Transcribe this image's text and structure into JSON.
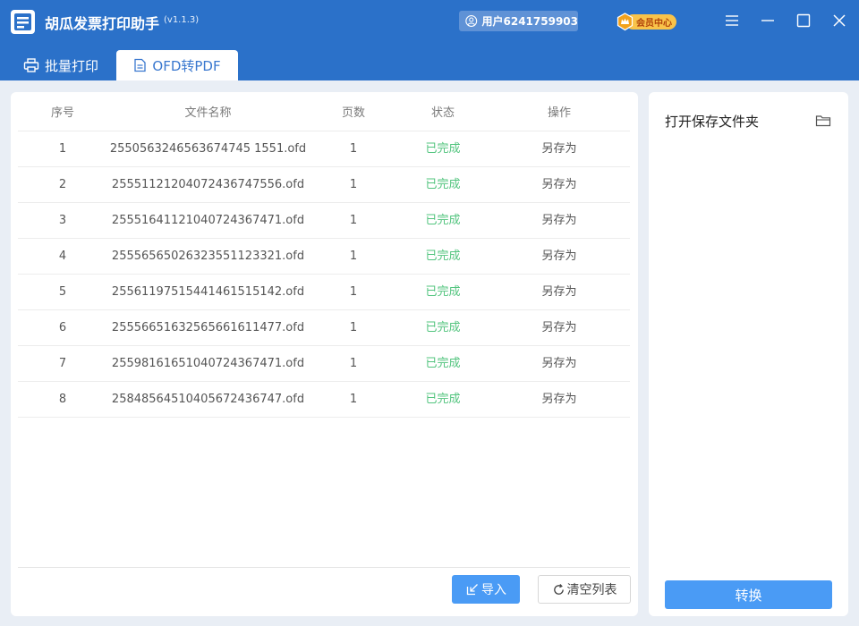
{
  "app": {
    "title": "胡瓜发票打印助手",
    "version": "(v1.1.3)",
    "user_label": "用户6241759903",
    "vip_label": "会员中心"
  },
  "colors": {
    "brand": "#2b71c9",
    "accent": "#4a9bf5",
    "status_done": "#52c47e",
    "vip": "#f9c34a"
  },
  "window_controls": [
    "menu-icon",
    "minimize-icon",
    "maximize-icon",
    "close-icon"
  ],
  "tabs": [
    {
      "label": "批量打印",
      "icon": "printer-icon",
      "active": false
    },
    {
      "label": "OFD转PDF",
      "icon": "document-icon",
      "active": true
    }
  ],
  "table": {
    "columns": [
      "序号",
      "文件名称",
      "页数",
      "状态",
      "操作"
    ],
    "rows": [
      {
        "index": "1",
        "name": "2550563246563674745 1551.ofd",
        "pages": "1",
        "status": "已完成",
        "action": "另存为"
      },
      {
        "index": "2",
        "name": "25551121204072436747556.ofd",
        "pages": "1",
        "status": "已完成",
        "action": "另存为"
      },
      {
        "index": "3",
        "name": "25551641121040724367471.ofd",
        "pages": "1",
        "status": "已完成",
        "action": "另存为"
      },
      {
        "index": "4",
        "name": "25556565026323551123321.ofd",
        "pages": "1",
        "status": "已完成",
        "action": "另存为"
      },
      {
        "index": "5",
        "name": "25561197515441461515142.ofd",
        "pages": "1",
        "status": "已完成",
        "action": "另存为"
      },
      {
        "index": "6",
        "name": "25556651632565661611477.ofd",
        "pages": "1",
        "status": "已完成",
        "action": "另存为"
      },
      {
        "index": "7",
        "name": "25598161651040724367471.ofd",
        "pages": "1",
        "status": "已完成",
        "action": "另存为"
      },
      {
        "index": "8",
        "name": "25848564510405672436747.ofd",
        "pages": "1",
        "status": "已完成",
        "action": "另存为"
      }
    ]
  },
  "footer": {
    "import_label": "导入",
    "clear_label": "清空列表"
  },
  "side": {
    "open_folder_label": "打开保存文件夹",
    "convert_label": "转换"
  }
}
